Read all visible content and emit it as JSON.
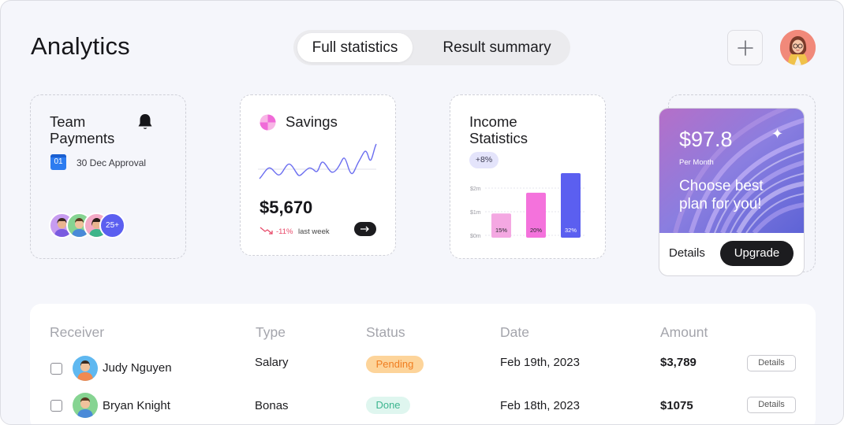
{
  "header": {
    "title": "Analytics",
    "tabs": [
      "Full statistics",
      "Result summary"
    ],
    "active_tab": "Full statistics",
    "add_icon": "plus-icon",
    "user_avatar": "user-avatar-woman"
  },
  "team_payments": {
    "title_line1": "Team",
    "title_line2": "Payments",
    "bell_icon": "bell-icon",
    "calendar_day": "01",
    "approval": "30 Dec Approval",
    "extra_count": "25+"
  },
  "savings": {
    "title": "Savings",
    "amount": "$5,670",
    "change": "-11%",
    "period": "last week",
    "trend_color": "#e84a6a"
  },
  "income": {
    "title_line1": "Income",
    "title_line2": "Statistics",
    "badge": "+8%",
    "chart_data": {
      "type": "bar",
      "y_ticks": [
        "$2m",
        "$1m",
        "$0m"
      ],
      "ylim": [
        0,
        2.8
      ],
      "values": [
        1.05,
        1.95,
        2.8
      ],
      "labels": [
        "15%",
        "20%",
        "32%"
      ],
      "colors": [
        "#f4a8e2",
        "#f472dc",
        "#5b5ff0"
      ]
    }
  },
  "promo": {
    "price": "$97.8",
    "period": "Per Month",
    "headline_line1": "Choose best",
    "headline_line2": "plan for you!",
    "details": "Details",
    "upgrade": "Upgrade"
  },
  "table": {
    "columns": [
      "Receiver",
      "Type",
      "Status",
      "Date",
      "Amount"
    ],
    "rows": [
      {
        "name": "Judy Nguyen",
        "type": "Salary",
        "status": "Pending",
        "date": "Feb 19th, 2023",
        "amount": "$3,789",
        "action": "Details"
      },
      {
        "name": "Bryan Knight",
        "type": "Bonas",
        "status": "Done",
        "date": "Feb 18th, 2023",
        "amount": "$1075",
        "action": "Details"
      }
    ]
  }
}
